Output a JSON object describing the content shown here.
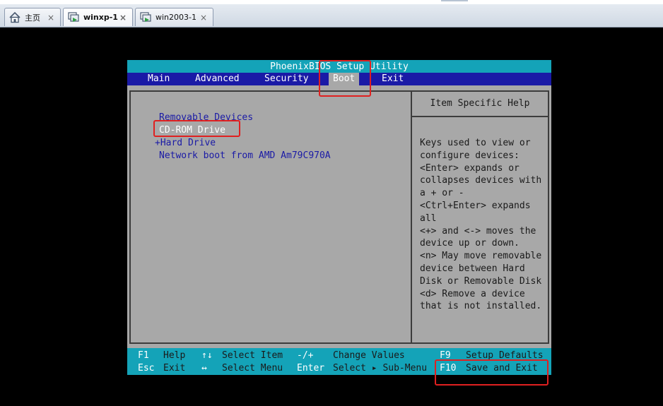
{
  "tabs": [
    {
      "label": "主页",
      "icon": "home-icon",
      "close": "×"
    },
    {
      "label": "winxp-1",
      "icon": "vm-icon",
      "close": "×",
      "active": true
    },
    {
      "label": "win2003-1",
      "icon": "vm-icon",
      "close": "×"
    }
  ],
  "bios": {
    "title": "PhoenixBIOS Setup Utility",
    "menu": [
      "Main",
      "Advanced",
      "Security",
      "Boot",
      "Exit"
    ],
    "active_menu": "Boot",
    "boot_items": [
      "Removable Devices",
      "CD-ROM Drive",
      "+Hard Drive",
      "Network boot from AMD Am79C970A"
    ],
    "selected_boot_item": "CD-ROM Drive",
    "help_title": "Item Specific Help",
    "help_lines": [
      "Keys used to view or",
      "configure devices:",
      "<Enter> expands or",
      "collapses devices with",
      "a + or -",
      "<Ctrl+Enter> expands",
      "all",
      "<+> and <-> moves the",
      "device up or down.",
      "<n> May move removable",
      "device between Hard",
      "Disk or Removable Disk",
      "<d> Remove a device",
      "that is not installed."
    ],
    "footer": {
      "row1": [
        {
          "key": "F1",
          "desc": "Help"
        },
        {
          "key": "↑↓",
          "desc": "Select Item"
        },
        {
          "key": "-/+",
          "desc": "Change Values"
        },
        {
          "key": "F9",
          "desc": "Setup Defaults"
        }
      ],
      "row2": [
        {
          "key": "Esc",
          "desc": "Exit"
        },
        {
          "key": "↔",
          "desc": "Select Menu"
        },
        {
          "key": "Enter",
          "desc": "Select ▸ Sub-Menu"
        },
        {
          "key": "F10",
          "desc": "Save and Exit"
        }
      ]
    }
  },
  "colors": {
    "bios_blue": "#1a1aa6",
    "bios_cyan": "#14a3b8",
    "bios_gray": "#a8a8a8",
    "highlight_red": "#e02020"
  }
}
